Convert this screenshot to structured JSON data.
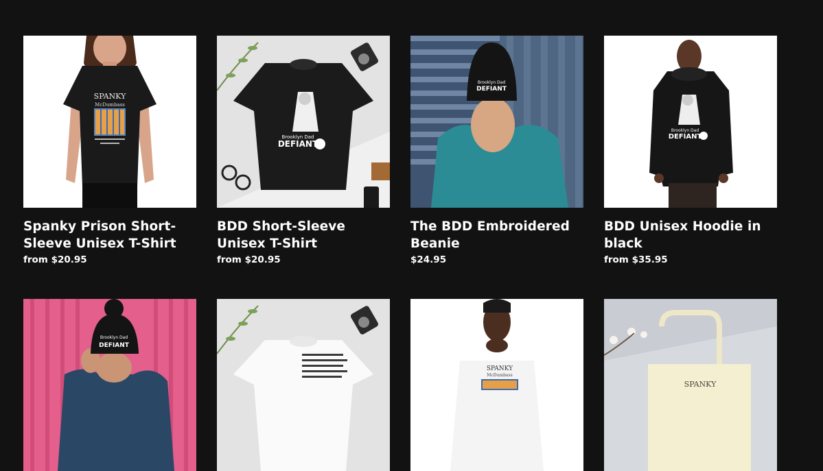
{
  "products": [
    {
      "title": "Spanky Prison Short-Sleeve Unisex T-Shirt",
      "price": "from $20.95",
      "image_alt": "Woman wearing black Spanky McDumbass t-shirt",
      "graphic_title": "SPANKY",
      "graphic_sub": "McDumbass"
    },
    {
      "title": "BDD Short-Sleeve Unisex T-Shirt",
      "price": "from $20.95",
      "image_alt": "Black BDD Defiant t-shirt flat lay",
      "graphic_title": "DEFIANT",
      "graphic_sub": "Brooklyn Dad"
    },
    {
      "title": "The BDD Embroidered Beanie",
      "price": "$24.95",
      "image_alt": "Man in teal sweater wearing black beanie",
      "graphic_title": "DEFIANT",
      "graphic_sub": "Brooklyn Dad"
    },
    {
      "title": "BDD Unisex Hoodie in black",
      "price": "from $35.95",
      "image_alt": "Man wearing black BDD Defiant hoodie",
      "graphic_title": "DEFIANT",
      "graphic_sub": "Brooklyn Dad"
    },
    {
      "title": "",
      "price": "",
      "image_alt": "Person wearing pom-pom beanie against pink wall",
      "graphic_title": "DEFIANT",
      "graphic_sub": "Brooklyn Dad"
    },
    {
      "title": "",
      "price": "",
      "image_alt": "White t-shirt flat lay with text print",
      "graphic_title": "",
      "graphic_sub": ""
    },
    {
      "title": "",
      "price": "",
      "image_alt": "Man wearing white Spanky McDumbass t-shirt",
      "graphic_title": "SPANKY",
      "graphic_sub": "McDumbass"
    },
    {
      "title": "",
      "price": "",
      "image_alt": "Canvas tote bag with Spanky print",
      "graphic_title": "SPANKY",
      "graphic_sub": ""
    }
  ]
}
